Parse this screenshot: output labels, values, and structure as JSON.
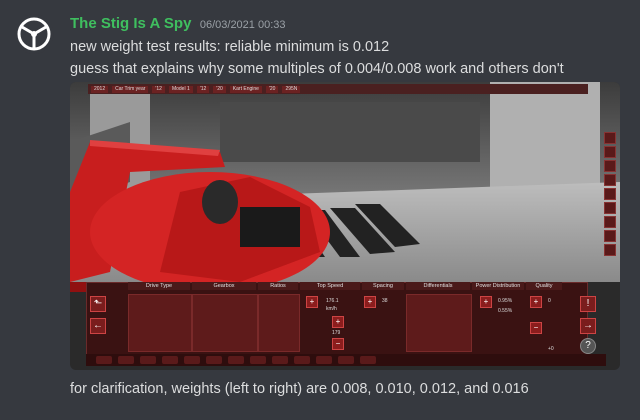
{
  "message": {
    "username": "The Stig Is A Spy",
    "timestamp": "06/03/2021 00:33",
    "lines": [
      "new weight test results: reliable minimum is 0.012",
      "guess that explains why some multiples of 0.004/0.008 work and others don't"
    ],
    "followup": "for clarification, weights (left to right) are 0.008, 0.010, 0.012, and 0.016"
  },
  "game": {
    "topbar": {
      "year": "2012",
      "trim": "Car Trim year",
      "model_year": "'12",
      "model": "Model 1",
      "year2": "'12",
      "year3": "'20",
      "engine": "Kart Engine",
      "year4": "'20",
      "power": "295N"
    },
    "columns": [
      "Drive Type",
      "Gearbox",
      "Ratios",
      "Top Speed",
      "Spacing",
      "Differentials",
      "Power Distribution",
      "Quality"
    ],
    "top_speed": {
      "value": "176.1",
      "unit": "km/h",
      "value2": "179"
    },
    "spacing_value": "38",
    "power_distribution": [
      "0.95%",
      "0.55%"
    ],
    "quality_values": [
      "0",
      "+0"
    ]
  }
}
